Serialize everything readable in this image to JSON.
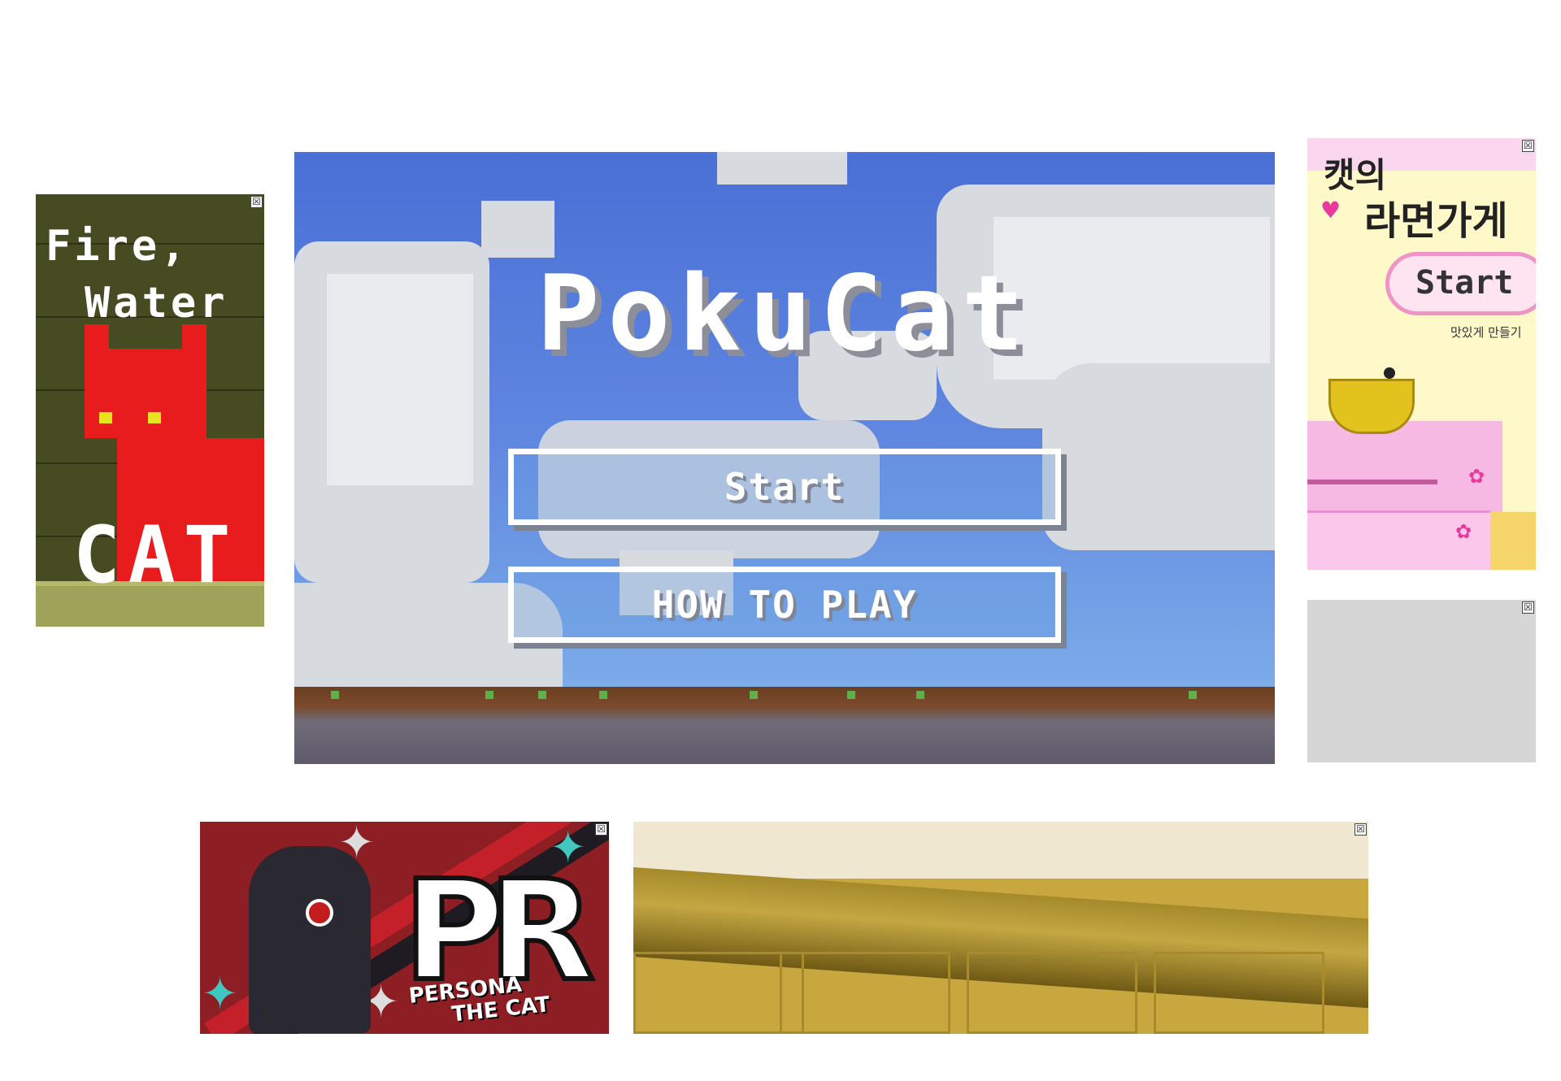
{
  "main_game": {
    "title": "PokuCat",
    "start_label": "Start",
    "how_to_play_label": "HOW TO PLAY"
  },
  "fire_water_cat": {
    "line1": "Fire,",
    "line2": "Water",
    "cat_word": "CAT"
  },
  "ramen": {
    "title_1": "캣의",
    "title_2": "라면가게",
    "start_label": "Start",
    "subtitle": "맛있게 만들기"
  },
  "persona": {
    "logo": "PR",
    "subtitle_1": "PERSONA",
    "subtitle_2": "THE CAT"
  },
  "close_glyph": "☒",
  "colors": {
    "sky": "#5f86e0",
    "cloud": "#d7dade",
    "fwc_bg": "#474b22",
    "cat_red": "#e81c1c",
    "ramen_bg": "#fff8c9",
    "ramen_pink": "#f6b9e4",
    "persona_red": "#8d1e24",
    "court_gold": "#c8a73f"
  }
}
